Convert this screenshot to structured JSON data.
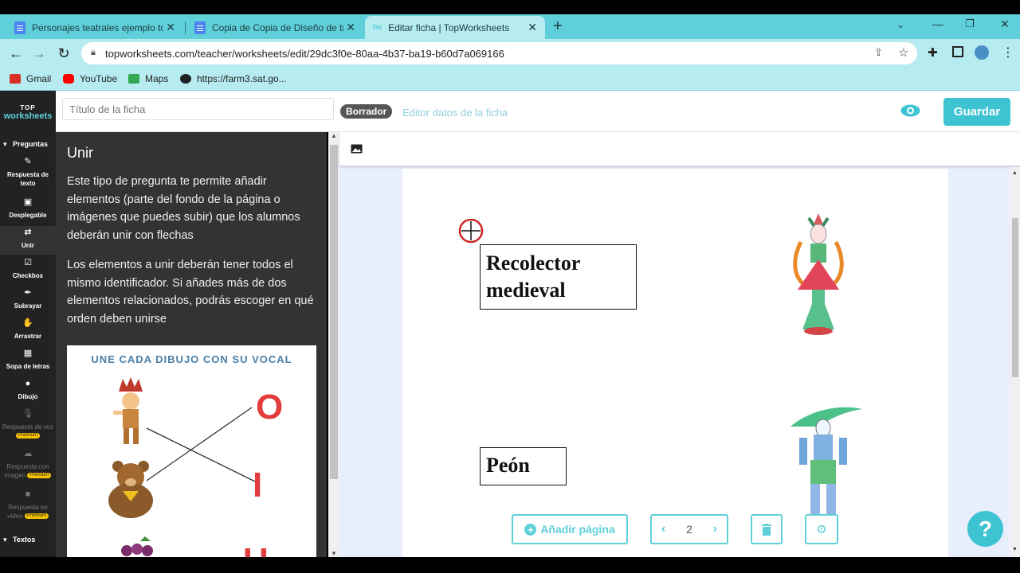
{
  "browser": {
    "tabs": [
      {
        "title": "Personajes teatrales ejemplo top"
      },
      {
        "title": "Copia de Copia de Diseño de tríc"
      },
      {
        "title": "Editar ficha | TopWorksheets"
      }
    ],
    "new_tab": "+",
    "url": "topworksheets.com/teacher/worksheets/edit/29dc3f0e-80aa-4b37-ba19-b60d7a069166",
    "bookmarks": [
      {
        "label": "Gmail",
        "color": "#d93025"
      },
      {
        "label": "YouTube",
        "color": "#ff0000"
      },
      {
        "label": "Maps",
        "color": "#34a853"
      },
      {
        "label": "https://farm3.sat.go...",
        "color": "#202124"
      }
    ]
  },
  "header": {
    "logo_top": "TOP",
    "logo_bottom": "worksheets",
    "title_placeholder": "Título de la ficha",
    "status_badge": "Borrador",
    "edit_link": "Editor datos de la ficha",
    "save_label": "Guardar"
  },
  "sidebar": {
    "section_questions": "Preguntas",
    "section_texts": "Textos",
    "items": [
      {
        "label": "Respuesta de texto",
        "icon": "edit-icon"
      },
      {
        "label": "Desplegable",
        "icon": "dropdown-icon"
      },
      {
        "label": "Unir",
        "icon": "arrows-icon"
      },
      {
        "label": "Checkbox",
        "icon": "checkbox-icon"
      },
      {
        "label": "Subrayar",
        "icon": "pen-icon"
      },
      {
        "label": "Arrastrar",
        "icon": "drag-icon"
      },
      {
        "label": "Sopa de letras",
        "icon": "grid-icon"
      },
      {
        "label": "Dibujo",
        "icon": "palette-icon"
      },
      {
        "label": "Respuesta de voz",
        "icon": "mic-icon",
        "premium": "Premium"
      },
      {
        "label": "Respuesta con imagen",
        "icon": "cloud-icon",
        "premium": "Premium"
      },
      {
        "label": "Respuesta en vídeo",
        "icon": "video-icon",
        "premium": "Premium"
      }
    ]
  },
  "panel": {
    "title": "Unir",
    "paragraph1": "Este tipo de pregunta te permite añadir elementos (parte del fondo de la página o imágenes que puedes subir) que los alumnos deberán unir con flechas",
    "paragraph2": "Los elementos a unir deberán tener todos el mismo identificador. Si añades más de dos elementos relacionados, podrás escoger en qué orden deben unirse",
    "example_heading": "UNE CADA DIBUJO CON SU VOCAL",
    "example_letters": [
      "O",
      "I",
      "U"
    ]
  },
  "worksheet": {
    "label1": "Recolector\nmedieval",
    "label2": "Peón"
  },
  "page_controls": {
    "add_page": "Añadir página",
    "page_number": "2"
  },
  "help_label": "?"
}
